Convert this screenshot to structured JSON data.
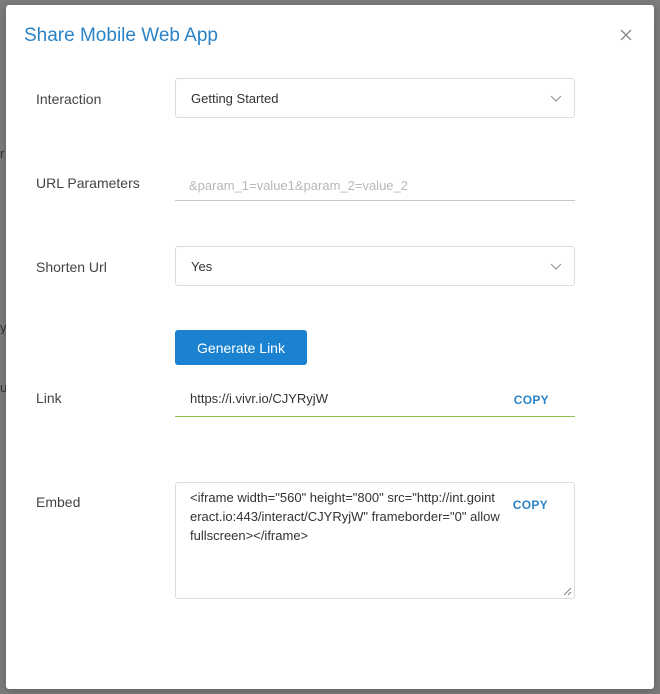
{
  "modal": {
    "title": "Share Mobile Web App"
  },
  "form": {
    "interaction": {
      "label": "Interaction",
      "selected": "Getting Started"
    },
    "url_parameters": {
      "label": "URL Parameters",
      "placeholder": "&param_1=value1&param_2=value_2",
      "value": ""
    },
    "shorten_url": {
      "label": "Shorten Url",
      "selected": "Yes"
    },
    "generate_button": "Generate Link",
    "link": {
      "label": "Link",
      "value": "https://i.vivr.io/CJYRyjW",
      "copy_label": "COPY"
    },
    "embed": {
      "label": "Embed",
      "value": "<iframe width=\"560\" height=\"800\" src=\"http://int.gointeract.io:443/interact/CJYRyjW\" frameborder=\"0\" allowfullscreen></iframe>",
      "copy_label": "COPY"
    }
  },
  "icons": {
    "close": "close-icon",
    "chevron": "chevron-down-icon"
  },
  "colors": {
    "accent": "#2b83c6",
    "primary_button": "#1a82d0",
    "link_underline": "#8bc34a"
  }
}
